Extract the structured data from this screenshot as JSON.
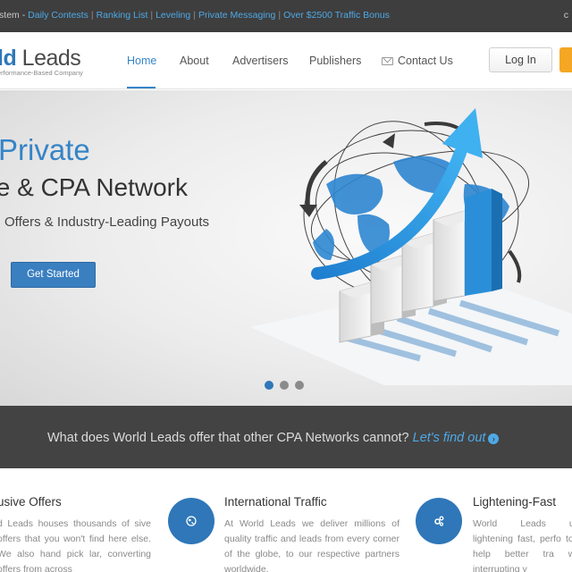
{
  "topbar": {
    "prefix": "Tracking System - ",
    "links": [
      "Daily Contests",
      "Ranking List",
      "Leveling",
      "Private Messaging",
      "Over $2500 Traffic Bonus"
    ],
    "separator": "|",
    "right": "c"
  },
  "header": {
    "logo_bold": "ld",
    "logo_rest": " Leads",
    "logo_tagline": "erformance-Based Company",
    "nav": [
      "Home",
      "About",
      "Advertisers",
      "Publishers",
      "Contact Us"
    ],
    "active_nav": "Home",
    "login_label": "Log In"
  },
  "hero": {
    "line1": "Private",
    "line2": "te & CPA Network",
    "line3": "Offers & Industry-Leading Payouts",
    "cta": "Get Started",
    "slides": 3,
    "active_slide": 1
  },
  "band": {
    "question": "What does World Leads offer that other CPA Networks cannot?",
    "link": "Let's find out",
    "arrow_icon": "chevron-right-circle-icon"
  },
  "features": [
    {
      "title": "usive Offers",
      "text": "d Leads houses thousands of sive offers that you won't find here else. We also hand pick lar, converting offers from across",
      "icon": null
    },
    {
      "title": "International Traffic",
      "text": "At World Leads we deliver millions of quality traffic and leads from every corner of the globe, to our respective partners worldwide.",
      "icon": "globe-icon"
    },
    {
      "title": "Lightening-Fast",
      "text": "World Leads utilizes lightening fast, perfo tools to help better tra without interrupting y",
      "icon": "gears-icon"
    }
  ],
  "colors": {
    "accent": "#3584c7",
    "topbar_bg": "#3e3e3e",
    "band_bg": "#434343",
    "orange": "#f5a623"
  }
}
